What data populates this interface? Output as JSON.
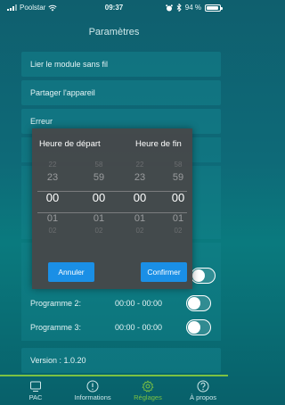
{
  "status_bar": {
    "carrier": "Poolstar",
    "time": "09:37",
    "battery": "94 %",
    "battery_level": 0.94
  },
  "page_title": "Paramètres",
  "menu": [
    {
      "label": "Lier le module sans fil"
    },
    {
      "label": "Partager l'appareil"
    },
    {
      "label": "Erreur"
    }
  ],
  "programs": [
    {
      "label": "Programme 2:",
      "time": "00:00 - 00:00"
    },
    {
      "label": "Programme 3:",
      "time": "00:00 - 00:00"
    }
  ],
  "version": "Version : 1.0.20",
  "modal": {
    "start_title": "Heure de départ",
    "end_title": "Heure de fin",
    "columns": [
      {
        "far_above": "22",
        "above": "23",
        "selected": "00",
        "below": "01",
        "far_below": "02"
      },
      {
        "far_above": "58",
        "above": "59",
        "selected": "00",
        "below": "01",
        "far_below": "02"
      },
      {
        "far_above": "22",
        "above": "23",
        "selected": "00",
        "below": "01",
        "far_below": "02"
      },
      {
        "far_above": "58",
        "above": "59",
        "selected": "00",
        "below": "01",
        "far_below": "02"
      }
    ],
    "cancel_label": "Annuler",
    "confirm_label": "Confirmer"
  },
  "tabbar": {
    "accent_color": "#7cc242",
    "tabs": [
      {
        "label": "PAC",
        "icon": "monitor-icon",
        "active": false
      },
      {
        "label": "Informations",
        "icon": "info-icon",
        "active": false
      },
      {
        "label": "Réglages",
        "icon": "gear-icon",
        "active": true
      },
      {
        "label": "À propos",
        "icon": "question-icon",
        "active": false
      }
    ]
  }
}
